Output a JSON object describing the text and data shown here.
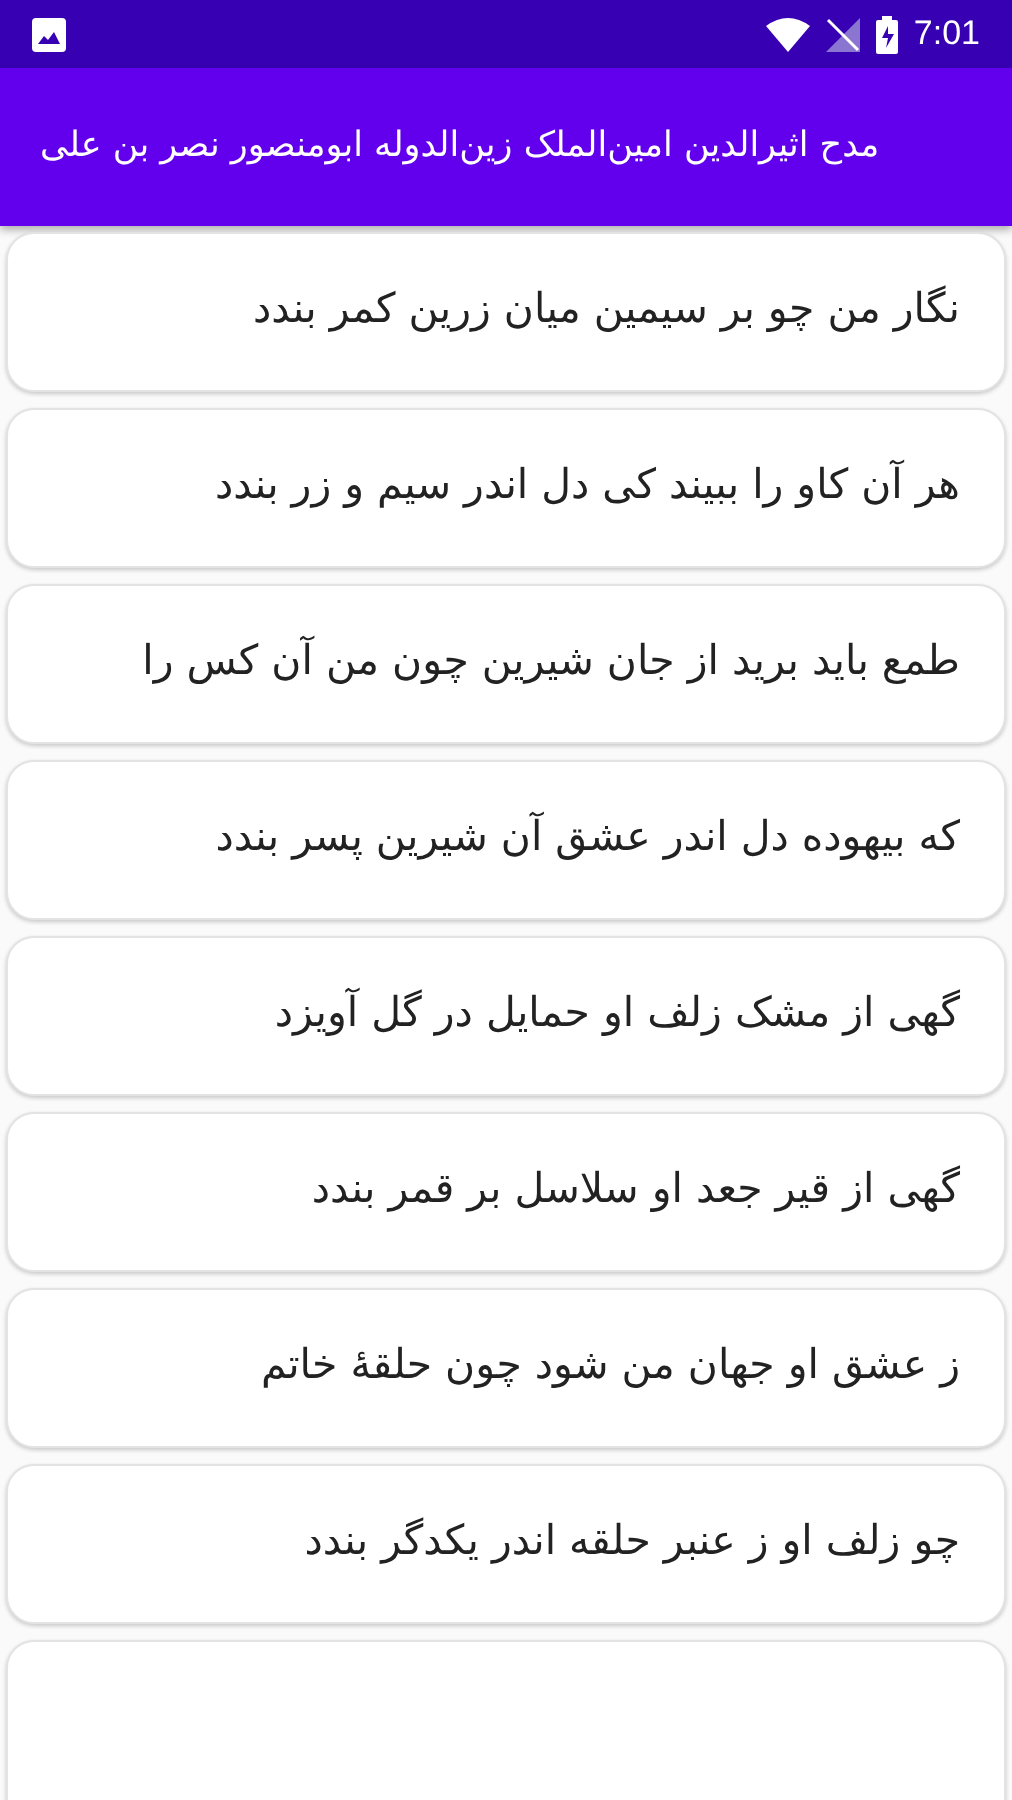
{
  "status_bar": {
    "time": "7:01"
  },
  "app_bar": {
    "title": "مدح اثیرالدین امین‌الملک زین‌الدوله ابومنصور نصر بن علی"
  },
  "verses": [
    {
      "text": "نگار من چو بر سیمین میان زرین کمر بندد"
    },
    {
      "text": "هر آن کاو را ببیند کی دل اندر سیم و زر بندد"
    },
    {
      "text": "طمع باید برید از جان شیرین چون من آن کس را"
    },
    {
      "text": "که بیهوده دل اندر عشق آن شیرین پسر بندد"
    },
    {
      "text": "گهی از مشک زلف او حمایل در گل آویزد"
    },
    {
      "text": "گهی از قیر جعد او سلاسل بر قمر بندد"
    },
    {
      "text": "ز عشق او جهان من شود چون حلقهٔ خاتم"
    },
    {
      "text": "چو زلف او ز عنبر حلقه اندر یکدگر بندد"
    },
    {
      "kind": "cut"
    }
  ]
}
